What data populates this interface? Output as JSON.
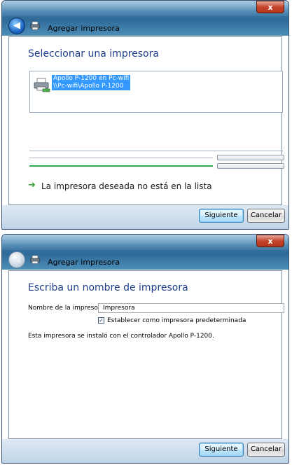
{
  "window1": {
    "title": "Agregar impresora",
    "close_label": "x",
    "heading": "Seleccionar una impresora",
    "printer_list": [
      {
        "line1": "Apollo P-1200 en Pc-wifi",
        "line2": "\\\\Pc-wifi\\Apollo P-1200"
      }
    ],
    "link_text": "La impresora deseada no está en la lista",
    "next_button": "Siguiente",
    "cancel_button": "Cancelar"
  },
  "window2": {
    "title": "Agregar impresora",
    "close_label": "x",
    "heading": "Escriba un nombre de impresora",
    "name_label": "Nombre de la impresora:",
    "name_value": "Impresora",
    "default_checkbox_label": "Establecer como impresora predeterminada",
    "default_checked": true,
    "info_text": "Esta impresora se instaló con el controlador Apollo P-1200.",
    "next_button": "Siguiente",
    "cancel_button": "Cancelar"
  },
  "colors": {
    "heading": "#1e3f8c",
    "selection": "#3399ff",
    "progress": "#2fa84f"
  }
}
